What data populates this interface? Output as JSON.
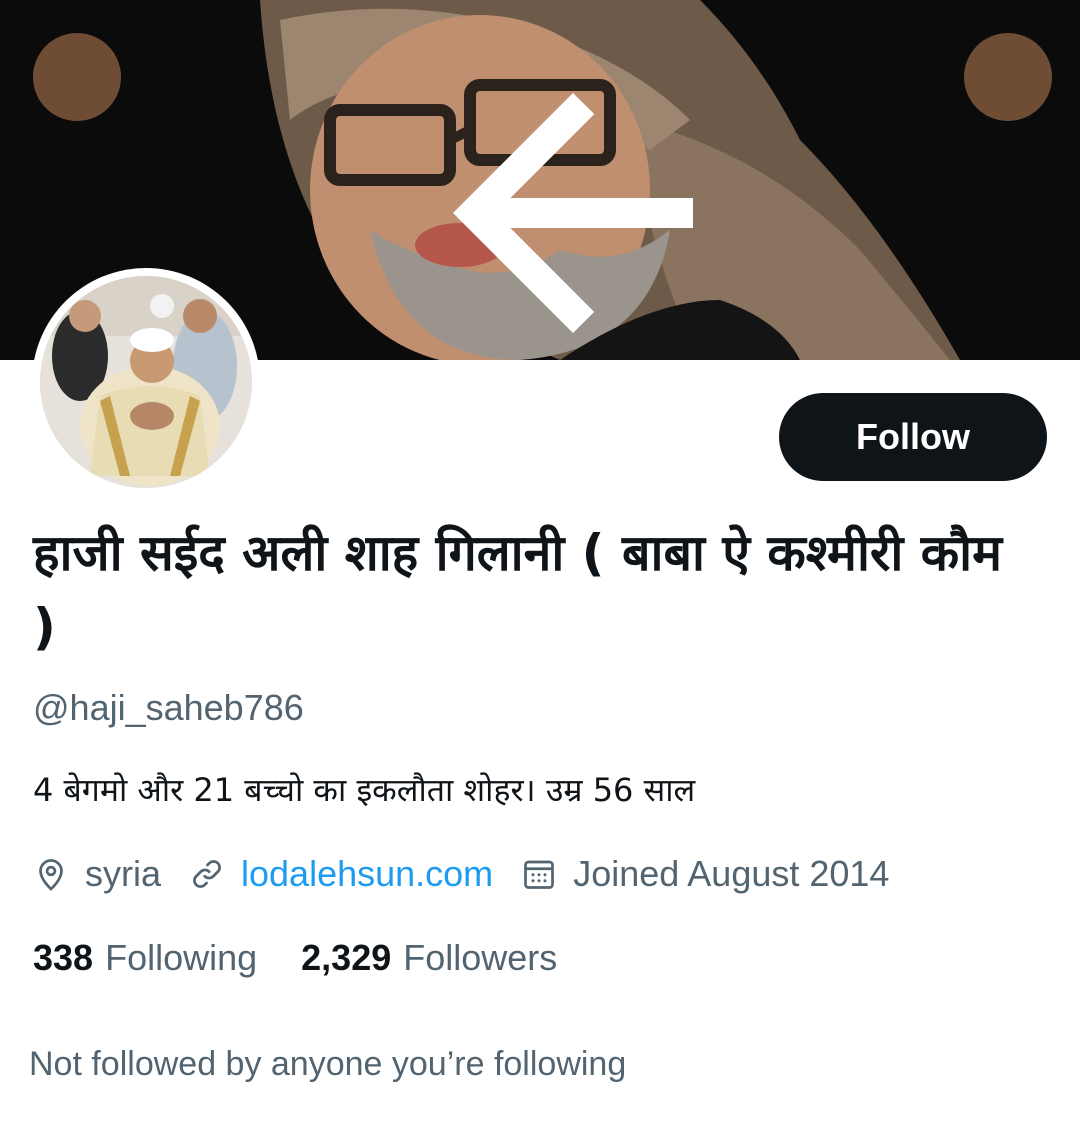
{
  "header": {
    "back_icon": "arrow-left-icon",
    "more_icon": "more-vertical-icon",
    "button_bg": "#78543a"
  },
  "profile": {
    "display_name": "हाजी सईद अली शाह गिलानी ( बाबा ऐ कश्मीरी कौम )",
    "handle": "@haji_saheb786",
    "bio": "4 बेगमो और 21 बच्चो का इकलौता शोहर। उम्र 56 साल",
    "follow_label": "Follow",
    "location": "syria",
    "website": "lodalehsun.com",
    "joined": "Joined August 2014",
    "following_count": "338",
    "following_label": "Following",
    "followers_count": "2,329",
    "followers_label": "Followers",
    "followed_by_text": "Not followed by anyone you’re following"
  },
  "colors": {
    "text_primary": "#0f1419",
    "text_secondary": "#536471",
    "link": "#1d9bf0",
    "follow_button": "#0f1419"
  }
}
